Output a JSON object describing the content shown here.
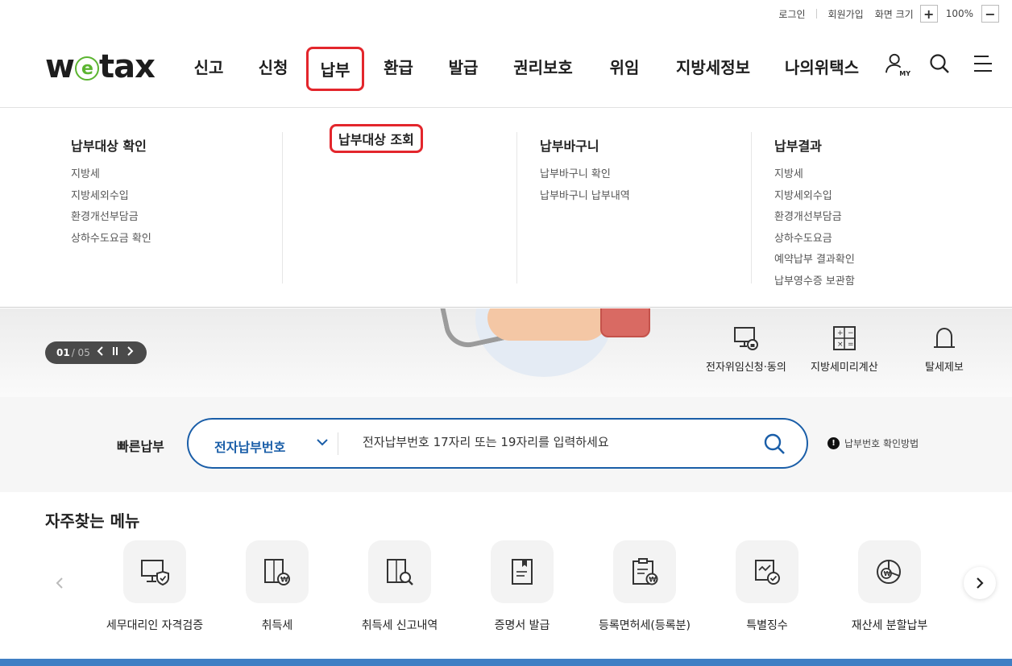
{
  "util": {
    "login": "로그인",
    "signup": "회원가입",
    "zoom_label": "화면 크기",
    "zoom_in": "+",
    "zoom_value": "100%",
    "zoom_out": "−"
  },
  "header": {
    "logo_w": "w",
    "logo_e": "e",
    "logo_tax": "tax",
    "nav": [
      "신고",
      "신청",
      "납부",
      "환급",
      "발급",
      "권리보호",
      "위임",
      "지방세정보",
      "나의위택스"
    ],
    "active_nav": "납부",
    "my_label": "MY"
  },
  "mega_menu": {
    "columns": [
      {
        "title": "납부대상 확인",
        "items": [
          "지방세",
          "지방세외수입",
          "환경개선부담금",
          "상하수도요금 확인"
        ]
      },
      {
        "title": "납부대상 조회",
        "items": []
      },
      {
        "title": "납부바구니",
        "items": [
          "납부바구니 확인",
          "납부바구니 납부내역"
        ]
      },
      {
        "title": "납부결과",
        "items": [
          "지방세",
          "지방세외수입",
          "환경개선부담금",
          "상하수도요금",
          "예약납부 결과확인",
          "납부영수증 보관함"
        ]
      }
    ],
    "highlight_color": "#e3262c"
  },
  "banner": {
    "slide_current": "01",
    "slide_total": "/ 05",
    "quick_links": [
      "전자위임신청·동의",
      "지방세미리계산",
      "탈세제보"
    ]
  },
  "fast_pay": {
    "label": "빠른납부",
    "select_value": "전자납부번호",
    "placeholder": "전자납부번호 17자리 또는 19자리를 입력하세요",
    "help_text": "납부번호 확인방법",
    "accent": "#1a5ea8"
  },
  "favorites": {
    "title": "자주찾는 메뉴",
    "items": [
      {
        "label": "세무대리인 자격검증",
        "icon": "monitor-shield-icon"
      },
      {
        "label": "취득세",
        "icon": "building-coin-icon"
      },
      {
        "label": "취득세 신고내역",
        "icon": "building-search-icon"
      },
      {
        "label": "증명서 발급",
        "icon": "document-bookmark-icon"
      },
      {
        "label": "등록면허세(등록분)",
        "icon": "clipboard-coin-icon"
      },
      {
        "label": "특별징수",
        "icon": "folder-check-icon"
      },
      {
        "label": "재산세 분할납부",
        "icon": "pie-chart-coin-icon"
      }
    ]
  }
}
